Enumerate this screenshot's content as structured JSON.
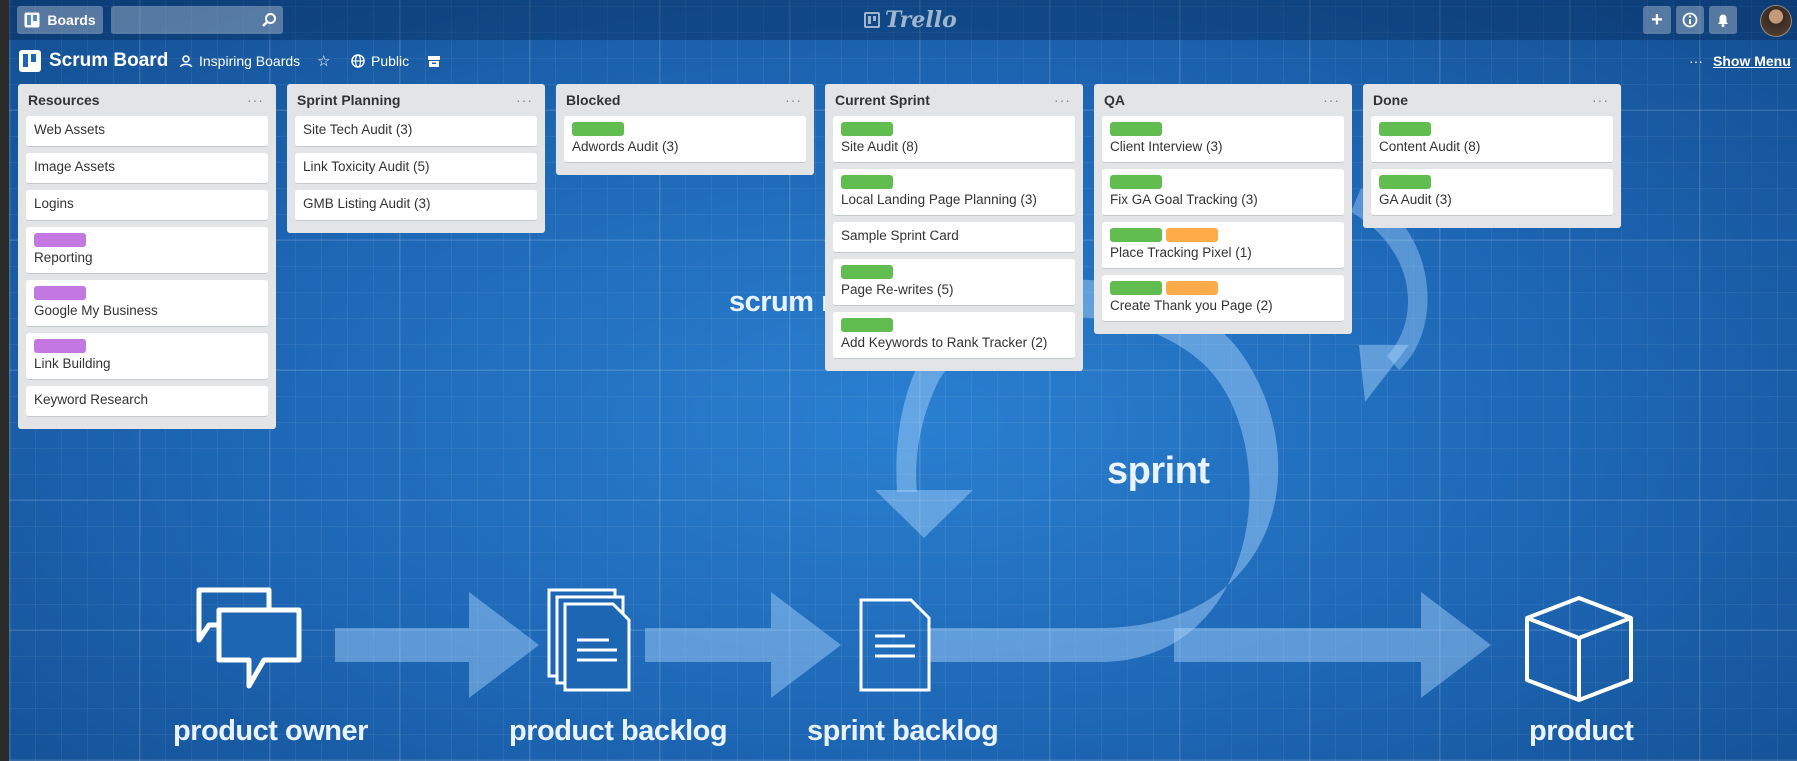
{
  "header": {
    "boards_label": "Boards",
    "search_value": "",
    "logo_text": "Trello"
  },
  "board": {
    "title": "Scrum Board",
    "team": "Inspiring Boards",
    "visibility": "Public",
    "show_menu": "Show Menu",
    "menu_glyph": "···"
  },
  "colors": {
    "green": "#61bd4f",
    "purple": "#c377e0",
    "orange": "#ffab4a"
  },
  "lists": [
    {
      "title": "Resources",
      "cards": [
        {
          "title": "Web Assets",
          "labels": []
        },
        {
          "title": "Image Assets",
          "labels": []
        },
        {
          "title": "Logins",
          "labels": []
        },
        {
          "title": "Reporting",
          "labels": [
            "purple"
          ]
        },
        {
          "title": "Google My Business",
          "labels": [
            "purple"
          ]
        },
        {
          "title": "Link Building",
          "labels": [
            "purple"
          ]
        },
        {
          "title": "Keyword Research",
          "labels": []
        }
      ]
    },
    {
      "title": "Sprint Planning",
      "cards": [
        {
          "title": "Site Tech Audit (3)",
          "labels": []
        },
        {
          "title": "Link Toxicity Audit (5)",
          "labels": []
        },
        {
          "title": "GMB Listing Audit (3)",
          "labels": []
        }
      ]
    },
    {
      "title": "Blocked",
      "cards": [
        {
          "title": "Adwords Audit (3)",
          "labels": [
            "green"
          ]
        }
      ]
    },
    {
      "title": "Current Sprint",
      "cards": [
        {
          "title": "Site Audit (8)",
          "labels": [
            "green"
          ]
        },
        {
          "title": "Local Landing Page Planning (3)",
          "labels": [
            "green"
          ]
        },
        {
          "title": "Sample Sprint Card",
          "labels": []
        },
        {
          "title": "Page Re-writes (5)",
          "labels": [
            "green"
          ]
        },
        {
          "title": "Add Keywords to Rank Tracker (2)",
          "labels": [
            "green"
          ]
        }
      ]
    },
    {
      "title": "QA",
      "cards": [
        {
          "title": "Client Interview (3)",
          "labels": [
            "green"
          ]
        },
        {
          "title": "Fix GA Goal Tracking (3)",
          "labels": [
            "green"
          ]
        },
        {
          "title": "Place Tracking Pixel (1)",
          "labels": [
            "green",
            "orange"
          ]
        },
        {
          "title": "Create Thank you Page (2)",
          "labels": [
            "green",
            "orange"
          ]
        }
      ]
    },
    {
      "title": "Done",
      "cards": [
        {
          "title": "Content Audit (8)",
          "labels": [
            "green"
          ]
        },
        {
          "title": "GA Audit (3)",
          "labels": [
            "green"
          ]
        }
      ]
    }
  ],
  "background": {
    "sprint": "sprint",
    "scrum": "scrum m",
    "product_owner": "product owner",
    "product_backlog": "product backlog",
    "sprint_backlog": "sprint backlog",
    "product": "product"
  }
}
